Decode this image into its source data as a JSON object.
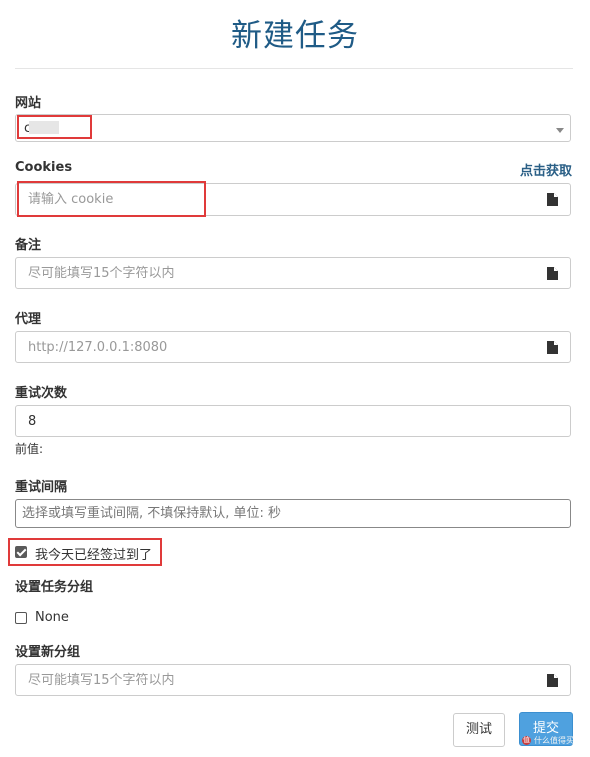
{
  "title": "新建任务",
  "site": {
    "label": "网站",
    "value": "c"
  },
  "cookies": {
    "label": "Cookies",
    "fetch_link": "点击获取",
    "placeholder": "请输入 cookie"
  },
  "note": {
    "label": "备注",
    "placeholder": "尽可能填写15个字符以内"
  },
  "proxy": {
    "label": "代理",
    "placeholder": "http://127.0.0.1:8080"
  },
  "retry_count": {
    "label": "重试次数",
    "value": "8",
    "helper": "前值:"
  },
  "retry_interval": {
    "label": "重试间隔",
    "placeholder": "选择或填写重试间隔, 不填保持默认, 单位: 秒"
  },
  "signed_today": {
    "label": "我今天已经签过到了",
    "checked": true
  },
  "task_group": {
    "label": "设置任务分组",
    "option_label": "None",
    "checked": false
  },
  "new_group": {
    "label": "设置新分组",
    "placeholder": "尽可能填写15个字符以内"
  },
  "buttons": {
    "test": "测试",
    "submit": "提交"
  },
  "watermark": {
    "badge": "值",
    "text": "什么值得买"
  },
  "colors": {
    "title": "#1f5b86",
    "accent": "#4fa1df",
    "highlight_box": "#e03a3a",
    "link": "#2a5f86"
  },
  "icons": {
    "field_action": "file-icon",
    "select": "caret-down-icon"
  }
}
